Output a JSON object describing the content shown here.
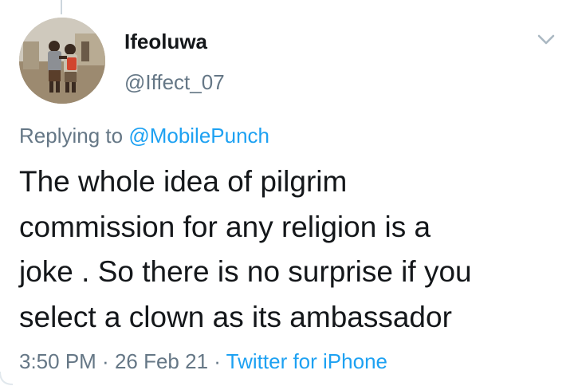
{
  "tweet": {
    "author": {
      "display_name": "Ifeoluwa",
      "handle": "@Iffect_07",
      "avatar_icon": "avatar-photo-two-children"
    },
    "menu_icon": "chevron-down-icon",
    "reply": {
      "prefix": "Replying to ",
      "mention": "@MobilePunch"
    },
    "text_lines": [
      "The whole idea of pilgrim",
      "commission for any religion is a",
      "joke . So there is no surprise if you",
      "select a clown as its ambassador"
    ],
    "time": "3:50 PM",
    "separator": " · ",
    "date": "26 Feb 21",
    "source": "Twitter for iPhone"
  },
  "colors": {
    "text": "#14171a",
    "secondary": "#657786",
    "link": "#1da1f2",
    "thread_line": "#ccd6dd"
  }
}
